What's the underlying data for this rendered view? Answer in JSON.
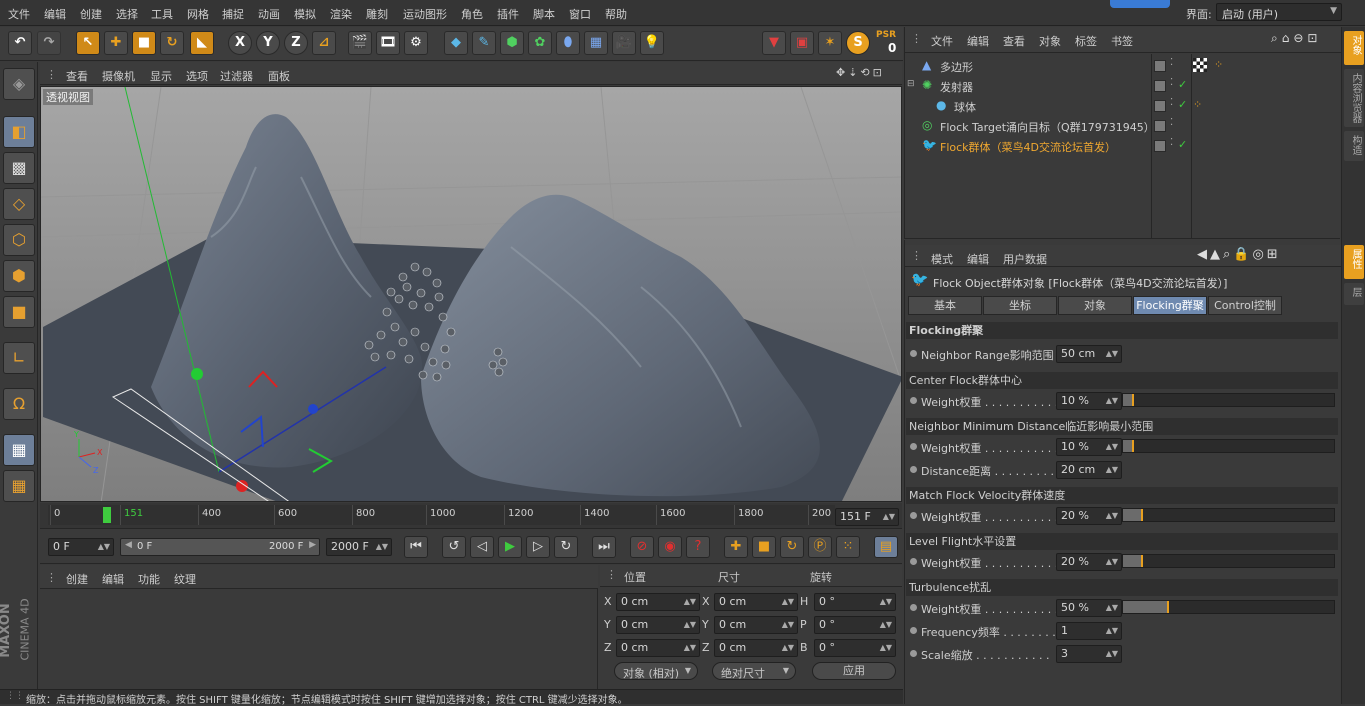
{
  "menu": [
    "文件",
    "编辑",
    "创建",
    "选择",
    "工具",
    "网格",
    "捕捉",
    "动画",
    "模拟",
    "渲染",
    "雕刻",
    "运动图形",
    "角色",
    "插件",
    "脚本",
    "窗口",
    "帮助"
  ],
  "layout_label": "界面:",
  "layout_value": "启动 (用户)",
  "psr": {
    "label": "PSR",
    "value": "0"
  },
  "viewport": {
    "menu": [
      "查看",
      "摄像机",
      "显示",
      "选项",
      "过滤器",
      "面板"
    ],
    "label": "透视视图"
  },
  "timeline": {
    "ticks": [
      "0",
      "151",
      "400",
      "600",
      "800",
      "1000",
      "1200",
      "1400",
      "1600",
      "1800",
      "200"
    ],
    "current_frame": "151 F",
    "playhead_fraction": 0.075
  },
  "playback": {
    "start": "0 F",
    "range_start": "0 F",
    "range_end": "2000 F",
    "end": "2000 F"
  },
  "material_menu": [
    "创建",
    "编辑",
    "功能",
    "纹理"
  ],
  "coords": {
    "headers": [
      "位置",
      "尺寸",
      "旋转"
    ],
    "rows": [
      {
        "a": "X",
        "av": "0 cm",
        "b": "X",
        "bv": "0 cm",
        "c": "H",
        "cv": "0 °"
      },
      {
        "a": "Y",
        "av": "0 cm",
        "b": "Y",
        "bv": "0 cm",
        "c": "P",
        "cv": "0 °"
      },
      {
        "a": "Z",
        "av": "0 cm",
        "b": "Z",
        "bv": "0 cm",
        "c": "B",
        "cv": "0 °"
      }
    ],
    "mode1": "对象 (相对)",
    "mode2": "绝对尺寸",
    "apply": "应用"
  },
  "object_manager": {
    "menu": [
      "文件",
      "编辑",
      "查看",
      "对象",
      "标签",
      "书签"
    ],
    "objects": [
      {
        "name": "多边形",
        "indent": 0,
        "color": "#cfcfcf"
      },
      {
        "name": "发射器",
        "indent": 0,
        "color": "#cfcfcf"
      },
      {
        "name": "球体",
        "indent": 1,
        "color": "#cfcfcf"
      },
      {
        "name": "Flock Target涌向目标（Q群179731945）",
        "indent": 0,
        "color": "#cfcfcf"
      },
      {
        "name": "Flock群体（菜鸟4D交流论坛首发）",
        "indent": 0,
        "color": "#f0a830"
      }
    ]
  },
  "attributes": {
    "menu": [
      "模式",
      "编辑",
      "用户数据"
    ],
    "title": "Flock Object群体对象 [Flock群体（菜鸟4D交流论坛首发）]",
    "tabs": [
      "基本",
      "坐标",
      "对象",
      "Flocking群聚",
      "Control控制"
    ],
    "active_tab": 3,
    "section_title": "Flocking群聚",
    "neighbor_range_label": "Neighbor Range影响范围",
    "neighbor_range_value": "50 cm",
    "groups": [
      {
        "title": "Center Flock群体中心",
        "params": [
          {
            "label": "Weight权重 . . . . . . . . . . .",
            "value": "10 %",
            "fraction": 0.1
          }
        ]
      },
      {
        "title": "Neighbor Minimum Distance临近影响最小范围",
        "params": [
          {
            "label": "Weight权重 . . . . . . . . . . .",
            "value": "10 %",
            "fraction": 0.1
          },
          {
            "label": "Distance距离 . . . . . . . . . .",
            "value": "20 cm"
          }
        ]
      },
      {
        "title": "Match Flock Velocity群体速度",
        "params": [
          {
            "label": "Weight权重 . . . . . . . . . . .",
            "value": "20 %",
            "fraction": 0.2
          }
        ]
      },
      {
        "title": "Level Flight水平设置",
        "params": [
          {
            "label": "Weight权重 . . . . . . . . . . .",
            "value": "20 %",
            "fraction": 0.2
          }
        ]
      },
      {
        "title": "Turbulence扰乱",
        "params": [
          {
            "label": "Weight权重 . . . . . . . . . . .",
            "value": "50 %",
            "fraction": 0.5
          },
          {
            "label": "Frequency频率 . . . . . . . .",
            "value": "1"
          },
          {
            "label": "Scale缩放 . . . . . . . . . . .",
            "value": "3"
          }
        ]
      }
    ]
  },
  "side_tabs": [
    "对象",
    "内容浏览器",
    "构造",
    "属性",
    "层"
  ],
  "status_bar": "缩放：点击并拖动鼠标缩放元素。按住 SHIFT 键量化缩放；节点编辑模式时按住 SHIFT 键增加选择对象；按住 CTRL 键减少选择对象。",
  "brand": {
    "line1": "MAXON",
    "line2": "CINEMA 4D"
  },
  "icons": {
    "top_toolbar": [
      "undo-icon",
      "redo-icon",
      "live-select-icon",
      "move-icon",
      "scale-icon",
      "rotate-icon",
      "recent-tool-icon",
      "x-axis-icon",
      "y-axis-icon",
      "z-axis-icon",
      "coordinate-system-icon",
      "render-view-icon",
      "render-picture-queue-icon",
      "render-settings-icon",
      "cube-icon",
      "pen-icon",
      "subdivision-icon",
      "cloner-icon",
      "deformer-icon",
      "floor-icon",
      "camera-icon",
      "light-icon"
    ]
  }
}
